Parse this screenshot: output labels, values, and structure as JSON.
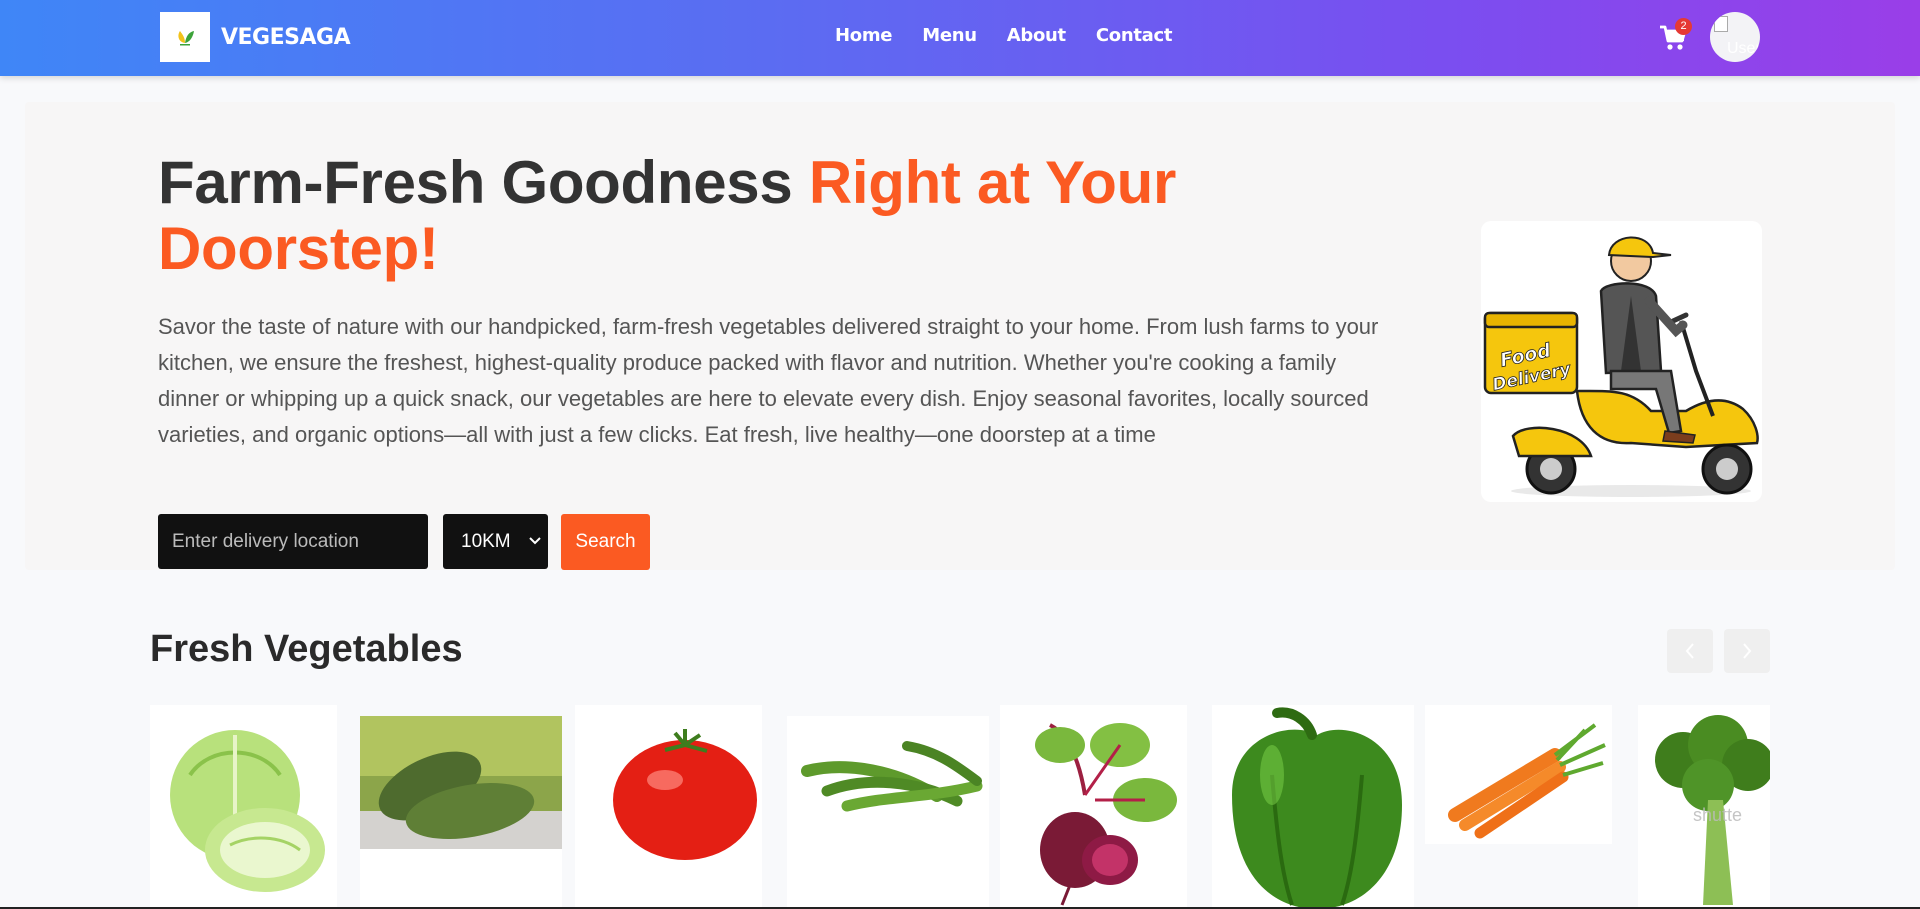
{
  "navbar": {
    "brand": "VEGESAGA",
    "links": [
      "Home",
      "Menu",
      "About",
      "Contact"
    ],
    "cart_count": "2",
    "avatar_alt": "User"
  },
  "hero": {
    "title_part1": "Farm-Fresh Goodness ",
    "title_part2": "Right at Your Doorstep!",
    "description": "Savor the taste of nature with our handpicked, farm-fresh vegetables delivered straight to your home. From lush farms to your kitchen, we ensure the freshest, highest-quality produce packed with flavor and nutrition. Whether you're cooking a family dinner or whipping up a quick snack, our vegetables are here to elevate every dish. Enjoy seasonal favorites, locally sourced varieties, and organic options—all with just a few clicks. Eat fresh, live healthy—one doorstep at a time",
    "location_placeholder": "Enter delivery location",
    "distance_selected": "10KM",
    "search_label": "Search",
    "delivery_badge_text": [
      "Food",
      "Delivery"
    ]
  },
  "vegetables": {
    "title": "Fresh Vegetables",
    "items": [
      "cabbage",
      "bitter-gourd",
      "tomato",
      "okra",
      "beetroot",
      "green-bell-pepper",
      "carrot",
      "broccoli"
    ],
    "broccoli_watermark": "shutte"
  },
  "colors": {
    "accent": "#fb5a22",
    "nav_gradient_start": "#3f86f7",
    "nav_gradient_end": "#9a3ee8"
  }
}
